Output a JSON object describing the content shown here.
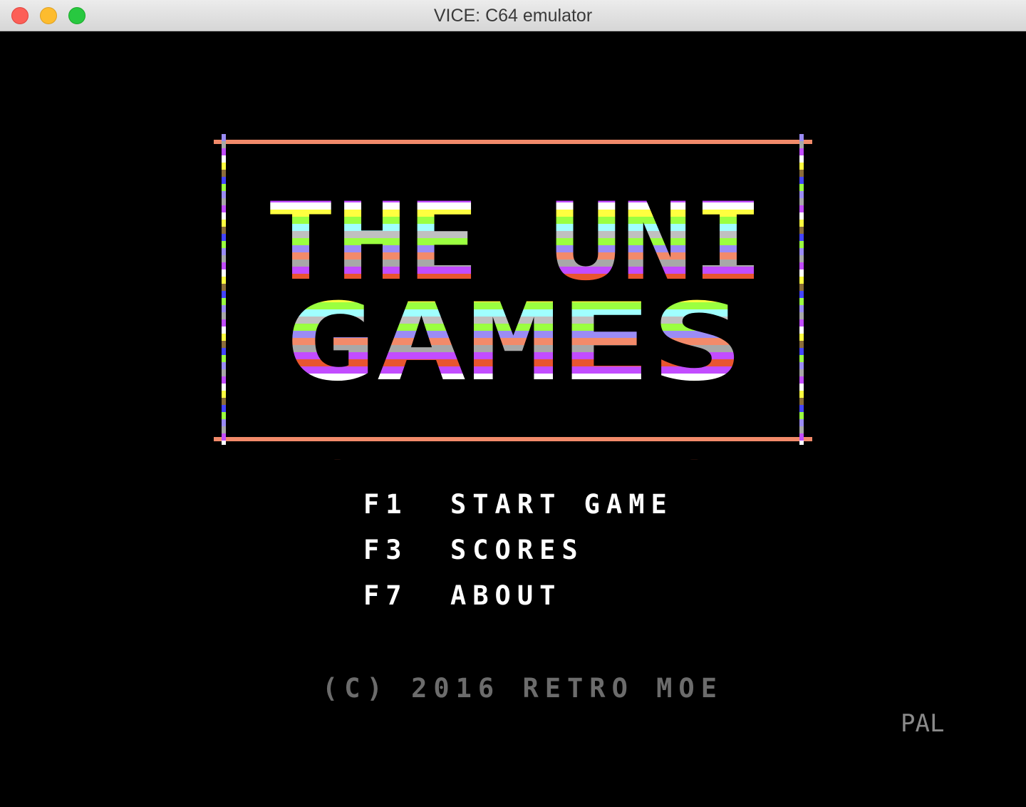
{
  "window": {
    "title": "VICE: C64 emulator"
  },
  "logo": {
    "line1": "THE UNI",
    "line2": "GAMES",
    "stripe_colors": [
      "#c24cff",
      "#e8552f",
      "#8b6d3a",
      "#a8a8a8",
      "#4444ff",
      "#ffffff",
      "#ffff40",
      "#9bff40",
      "#a0ffff",
      "#c0c0c0",
      "#9b8cf5",
      "#f28a6a"
    ],
    "frame_color": "#f28a6a"
  },
  "menu": [
    {
      "key": "F1",
      "label": "START GAME"
    },
    {
      "key": "F3",
      "label": "SCORES"
    },
    {
      "key": "F7",
      "label": "ABOUT"
    }
  ],
  "footer": {
    "copyright": "(C) 2016 RETRO MOE"
  },
  "status": {
    "video_standard": "PAL"
  }
}
